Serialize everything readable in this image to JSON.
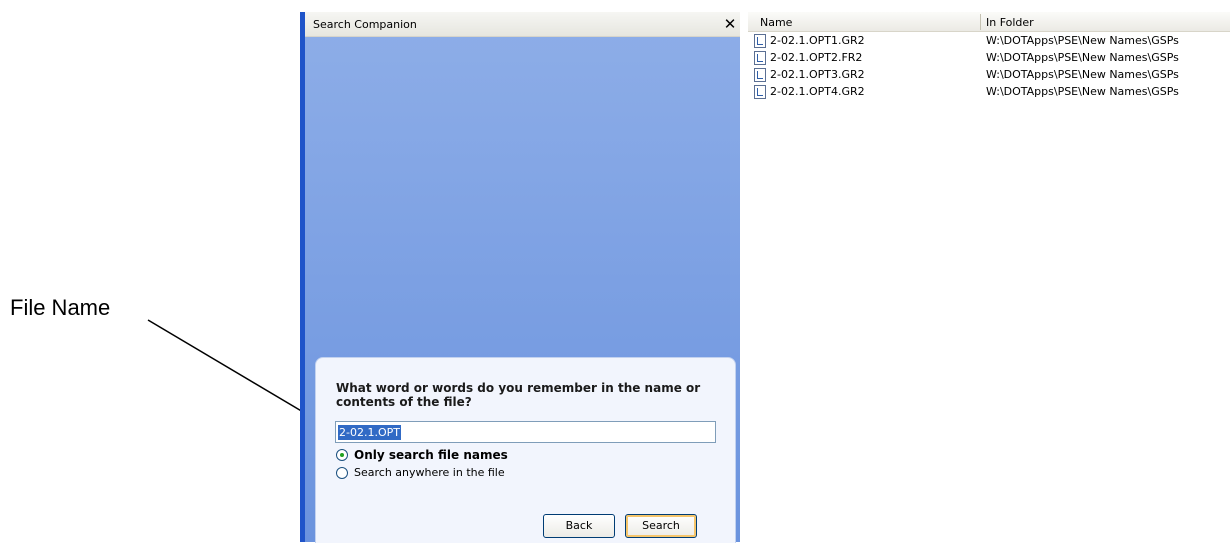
{
  "annotation": {
    "label": "File Name"
  },
  "search_companion": {
    "title": "Search Companion",
    "close_icon": "close-icon",
    "prompt": "What word or words do you remember in the name or contents of the file?",
    "search_value": "2-02.1.OPT",
    "options": [
      {
        "label": "Only search file names",
        "selected": true
      },
      {
        "label": "Search anywhere in the file",
        "selected": false
      }
    ],
    "buttons": {
      "back": "Back",
      "search": "Search"
    }
  },
  "results": {
    "columns": {
      "name": "Name",
      "folder": "In Folder"
    },
    "rows": [
      {
        "icon": "file-icon",
        "name": "2-02.1.OPT1.GR2",
        "folder": "W:\\DOTApps\\PSE\\New Names\\GSPs"
      },
      {
        "icon": "file-icon",
        "name": "2-02.1.OPT2.FR2",
        "folder": "W:\\DOTApps\\PSE\\New Names\\GSPs"
      },
      {
        "icon": "file-icon",
        "name": "2-02.1.OPT3.GR2",
        "folder": "W:\\DOTApps\\PSE\\New Names\\GSPs"
      },
      {
        "icon": "file-icon",
        "name": "2-02.1.OPT4.GR2",
        "folder": "W:\\DOTApps\\PSE\\New Names\\GSPs"
      }
    ]
  },
  "colors": {
    "window_edge": "#1f54c9",
    "pane_top": "#8eaee8",
    "pane_bottom": "#6b93de",
    "selection": "#316ac5"
  }
}
